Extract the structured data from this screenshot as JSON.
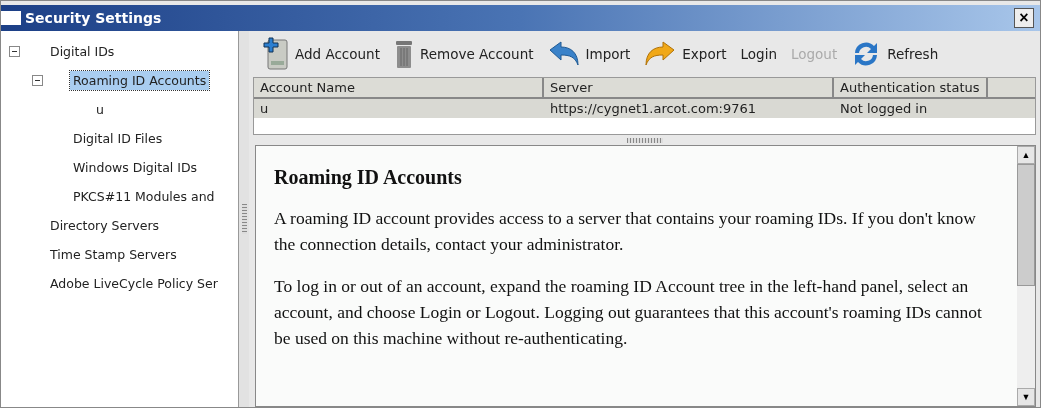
{
  "window": {
    "title": "Security Settings",
    "close": "×"
  },
  "tree": [
    {
      "label": "Digital IDs",
      "expanded": true,
      "selected": false,
      "children": [
        {
          "label": "Roaming ID Accounts",
          "expanded": true,
          "selected": true,
          "children": [
            {
              "label": "u",
              "selected": false
            }
          ]
        },
        {
          "label": "Digital ID Files",
          "selected": false
        },
        {
          "label": "Windows Digital IDs",
          "selected": false
        },
        {
          "label": "PKCS#11 Modules and",
          "selected": false
        }
      ]
    },
    {
      "label": "Directory Servers",
      "selected": false
    },
    {
      "label": "Time Stamp Servers",
      "selected": false
    },
    {
      "label": "Adobe LiveCycle Policy Ser",
      "selected": false
    }
  ],
  "toolbar": [
    {
      "label": "Add Account",
      "kind": "icon",
      "disabled": false
    },
    {
      "label": "Remove Account",
      "kind": "icon",
      "disabled": false
    },
    {
      "label": "Import",
      "kind": "icon",
      "disabled": false
    },
    {
      "label": "Export",
      "kind": "icon",
      "disabled": false
    },
    {
      "label": "Login",
      "kind": "text",
      "disabled": false
    },
    {
      "label": "Logout",
      "kind": "text",
      "disabled": true
    },
    {
      "label": "Refresh",
      "kind": "icon",
      "disabled": false
    }
  ],
  "table": {
    "columns": [
      "Account Name",
      "Server",
      "Authentication status"
    ],
    "rows": [
      {
        "cells": [
          "u",
          "https://cygnet1.arcot.com:9761",
          "Not logged in"
        ],
        "selected": true
      }
    ]
  },
  "content": {
    "heading": "Roaming ID Accounts",
    "paragraphs": [
      "A roaming ID account provides access to a server that contains your roaming IDs. If you don't know the connection details, contact your administrator.",
      "To log in or out of an account, expand the roaming ID Account tree in the left-hand panel, select an account, and choose Login or Logout. Logging out guarantees that this account's roaming IDs cannot be used on this machine without re-authenticating."
    ]
  },
  "scrollbar": {
    "up": "▲",
    "down": "▼"
  }
}
